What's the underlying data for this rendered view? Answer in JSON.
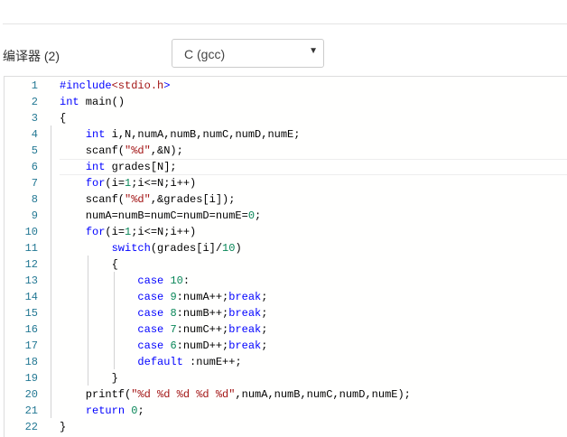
{
  "compiler": {
    "label": "编译器 (2)",
    "selected": "C (gcc)",
    "arrow": "▼"
  },
  "editor": {
    "current_line": 6,
    "lines": [
      [
        [
          "k",
          "#include"
        ],
        [
          "h",
          "<stdio.h"
        ],
        [
          "k",
          ">"
        ]
      ],
      [
        [
          "k",
          "int"
        ],
        [
          "p",
          " main()"
        ]
      ],
      [
        [
          "p",
          "{"
        ]
      ],
      [
        [
          "p",
          "    "
        ],
        [
          "k",
          "int"
        ],
        [
          "p",
          " i,N,numA,numB,numC,numD,numE;"
        ]
      ],
      [
        [
          "p",
          "    scanf("
        ],
        [
          "s",
          "\"%d\""
        ],
        [
          "p",
          ",&N);"
        ]
      ],
      [
        [
          "p",
          "    "
        ],
        [
          "k",
          "int"
        ],
        [
          "p",
          " grades[N];"
        ]
      ],
      [
        [
          "p",
          "    "
        ],
        [
          "k",
          "for"
        ],
        [
          "p",
          "(i="
        ],
        [
          "n",
          "1"
        ],
        [
          "p",
          ";i<=N;i++)"
        ]
      ],
      [
        [
          "p",
          "    scanf("
        ],
        [
          "s",
          "\"%d\""
        ],
        [
          "p",
          ",&grades[i]);"
        ]
      ],
      [
        [
          "p",
          "    numA=numB=numC=numD=numE="
        ],
        [
          "n",
          "0"
        ],
        [
          "p",
          ";"
        ]
      ],
      [
        [
          "p",
          "    "
        ],
        [
          "k",
          "for"
        ],
        [
          "p",
          "(i="
        ],
        [
          "n",
          "1"
        ],
        [
          "p",
          ";i<=N;i++)"
        ]
      ],
      [
        [
          "p",
          "        "
        ],
        [
          "k",
          "switch"
        ],
        [
          "p",
          "(grades[i]/"
        ],
        [
          "n",
          "10"
        ],
        [
          "p",
          ")"
        ]
      ],
      [
        [
          "p",
          "        {"
        ]
      ],
      [
        [
          "p",
          "            "
        ],
        [
          "k",
          "case"
        ],
        [
          "p",
          " "
        ],
        [
          "n",
          "10"
        ],
        [
          "p",
          ":"
        ]
      ],
      [
        [
          "p",
          "            "
        ],
        [
          "k",
          "case"
        ],
        [
          "p",
          " "
        ],
        [
          "n",
          "9"
        ],
        [
          "p",
          ":numA++;"
        ],
        [
          "k",
          "break"
        ],
        [
          "p",
          ";"
        ]
      ],
      [
        [
          "p",
          "            "
        ],
        [
          "k",
          "case"
        ],
        [
          "p",
          " "
        ],
        [
          "n",
          "8"
        ],
        [
          "p",
          ":numB++;"
        ],
        [
          "k",
          "break"
        ],
        [
          "p",
          ";"
        ]
      ],
      [
        [
          "p",
          "            "
        ],
        [
          "k",
          "case"
        ],
        [
          "p",
          " "
        ],
        [
          "n",
          "7"
        ],
        [
          "p",
          ":numC++;"
        ],
        [
          "k",
          "break"
        ],
        [
          "p",
          ";"
        ]
      ],
      [
        [
          "p",
          "            "
        ],
        [
          "k",
          "case"
        ],
        [
          "p",
          " "
        ],
        [
          "n",
          "6"
        ],
        [
          "p",
          ":numD++;"
        ],
        [
          "k",
          "break"
        ],
        [
          "p",
          ";"
        ]
      ],
      [
        [
          "p",
          "            "
        ],
        [
          "k",
          "default"
        ],
        [
          "p",
          " :numE++;"
        ]
      ],
      [
        [
          "p",
          "        }"
        ]
      ],
      [
        [
          "p",
          "    printf("
        ],
        [
          "s",
          "\"%d %d %d %d %d\""
        ],
        [
          "p",
          ",numA,numB,numC,numD,numE);"
        ]
      ],
      [
        [
          "p",
          "    "
        ],
        [
          "k",
          "return"
        ],
        [
          "p",
          " "
        ],
        [
          "n",
          "0"
        ],
        [
          "p",
          ";"
        ]
      ],
      [
        [
          "p",
          "}"
        ]
      ]
    ],
    "line_numbers": [
      "1",
      "2",
      "3",
      "4",
      "5",
      "6",
      "7",
      "8",
      "9",
      "10",
      "11",
      "12",
      "13",
      "14",
      "15",
      "16",
      "17",
      "18",
      "19",
      "20",
      "21",
      "22"
    ]
  }
}
